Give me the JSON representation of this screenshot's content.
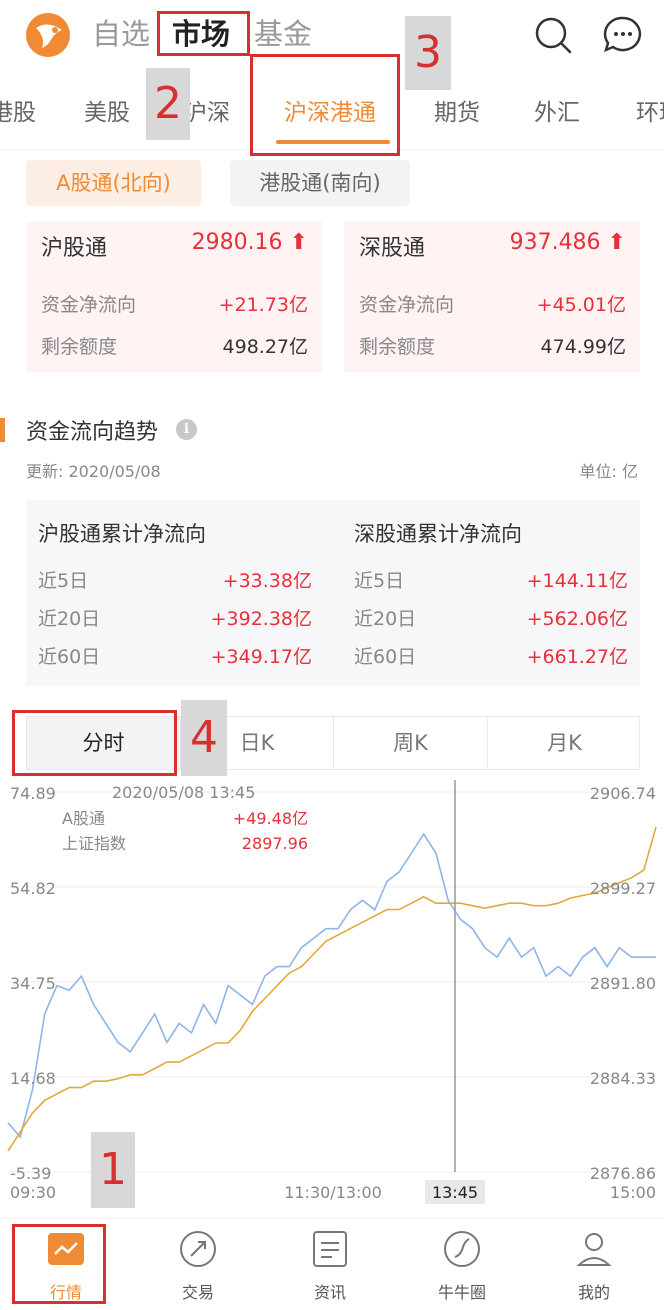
{
  "top_tabs": [
    "自选",
    "市场",
    "基金"
  ],
  "sub_tabs": [
    "港股",
    "美股",
    "沪深",
    "沪深港通",
    "期货",
    "外汇",
    "环球"
  ],
  "segments": [
    "A股通(北向)",
    "港股通(南向)"
  ],
  "cards": [
    {
      "name": "沪股通",
      "value": "2980.16",
      "rows": [
        {
          "k": "资金净流向",
          "v": "+21.73亿"
        },
        {
          "k": "剩余额度",
          "v": "498.27亿"
        }
      ]
    },
    {
      "name": "深股通",
      "value": "937.486",
      "rows": [
        {
          "k": "资金净流向",
          "v": "+45.01亿"
        },
        {
          "k": "剩余额度",
          "v": "474.99亿"
        }
      ]
    }
  ],
  "trend": {
    "title": "资金流向趋势",
    "update": "更新: 2020/05/08",
    "unit": "单位: 亿",
    "columns": [
      {
        "title": "沪股通累计净流向",
        "rows": [
          {
            "k": "近5日",
            "v": "+33.38亿"
          },
          {
            "k": "近20日",
            "v": "+392.38亿"
          },
          {
            "k": "近60日",
            "v": "+349.17亿"
          }
        ]
      },
      {
        "title": "深股通累计净流向",
        "rows": [
          {
            "k": "近5日",
            "v": "+144.11亿"
          },
          {
            "k": "近20日",
            "v": "+562.06亿"
          },
          {
            "k": "近60日",
            "v": "+661.27亿"
          }
        ]
      }
    ]
  },
  "period_tabs": [
    "分时",
    "日K",
    "周K",
    "月K"
  ],
  "chart_tooltip": {
    "datetime": "2020/05/08   13:45",
    "rows": [
      {
        "k": "A股通",
        "v": "+49.48亿"
      },
      {
        "k": "上证指数",
        "v": "2897.96"
      }
    ]
  },
  "chart_data": {
    "type": "line",
    "x_ticks": [
      "09:30",
      "11:30/13:00",
      "13:45",
      "15:00"
    ],
    "y_left_ticks": [
      "74.89",
      "54.82",
      "34.75",
      "14.68",
      "-5.39"
    ],
    "y_right_ticks": [
      "2906.74",
      "2899.27",
      "2891.80",
      "2884.33",
      "2876.86"
    ],
    "ylim_left": [
      -5.39,
      74.89
    ],
    "ylim_right": [
      2876.86,
      2906.74
    ],
    "series": [
      {
        "name": "A股通",
        "axis": "left",
        "color": "#8fb4e8",
        "values": [
          5,
          2,
          12,
          28,
          34,
          33,
          36,
          30,
          26,
          22,
          20,
          24,
          28,
          22,
          26,
          24,
          30,
          26,
          34,
          32,
          30,
          36,
          38,
          38,
          42,
          44,
          46,
          46,
          50,
          52,
          50,
          56,
          58,
          62,
          66,
          62,
          52,
          48,
          46,
          42,
          40,
          44,
          40,
          42,
          36,
          38,
          36,
          40,
          42,
          38,
          42,
          40,
          40,
          40
        ]
      },
      {
        "name": "上证指数",
        "axis": "right",
        "color": "#e4a83a",
        "values": [
          2878.5,
          2880.0,
          2881.5,
          2882.5,
          2883.0,
          2883.5,
          2883.5,
          2884.0,
          2884.0,
          2884.2,
          2884.5,
          2884.5,
          2885.0,
          2885.5,
          2885.5,
          2886.0,
          2886.5,
          2887.0,
          2887.0,
          2888.0,
          2889.5,
          2890.5,
          2891.5,
          2892.5,
          2893.0,
          2894.0,
          2895.0,
          2895.5,
          2896.0,
          2896.5,
          2897.0,
          2897.5,
          2897.5,
          2898.0,
          2898.5,
          2898.0,
          2898.0,
          2898.0,
          2897.8,
          2897.6,
          2897.8,
          2898.0,
          2898.0,
          2897.8,
          2897.8,
          2898.0,
          2898.4,
          2898.6,
          2898.8,
          2899.2,
          2899.6,
          2900.0,
          2900.6,
          2904.0
        ]
      }
    ],
    "crosshair_x_label": "13:45"
  },
  "bottom_nav": [
    "行情",
    "交易",
    "资讯",
    "牛牛圈",
    "我的"
  ],
  "annotations": [
    "1",
    "2",
    "3",
    "4"
  ]
}
